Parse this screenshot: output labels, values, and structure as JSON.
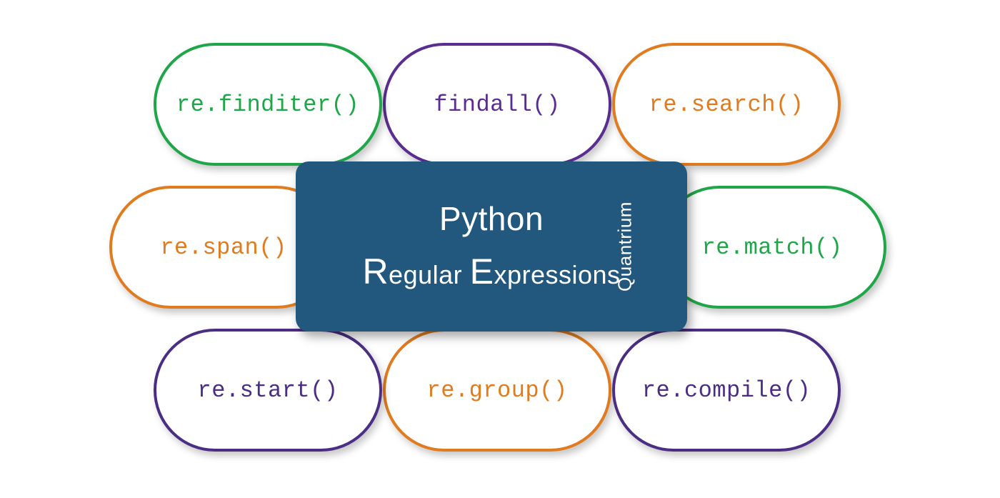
{
  "pills": {
    "finditer": "re.finditer()",
    "findall": "findall()",
    "search": "re.search()",
    "span": "re.span()",
    "match": "re.match()",
    "start": "re.start()",
    "group": "re.group()",
    "compile": "re.compile()"
  },
  "center": {
    "line1": "Python",
    "line2_cap1": "R",
    "line2_rest1": "egular ",
    "line2_cap2": "E",
    "line2_rest2": "xpressions",
    "brand": "Quantrium"
  },
  "colors": {
    "green": "#1fa648",
    "purple": "#5a2d91",
    "orange": "#e07b1f",
    "indigo": "#4b2e83",
    "card_bg": "#23587e"
  }
}
